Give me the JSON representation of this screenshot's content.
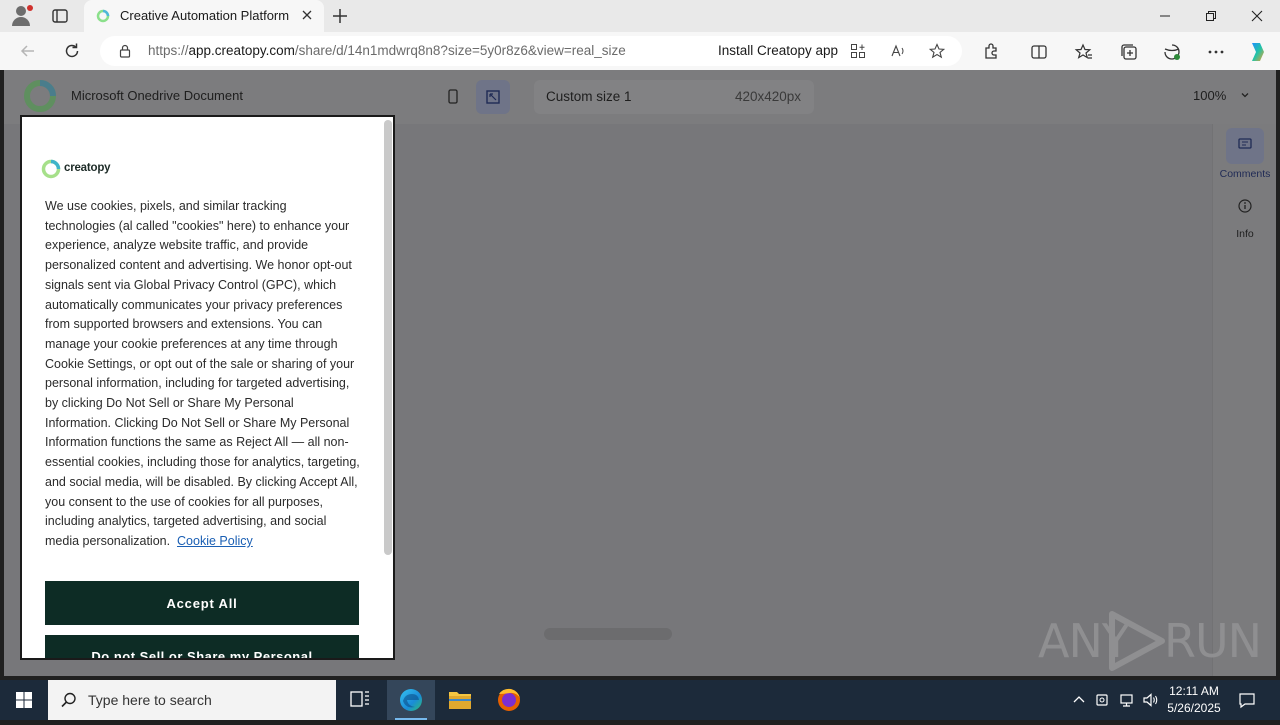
{
  "browser": {
    "tab_title": "Creative Automation Platform",
    "url_prefix": "https://",
    "url_host": "app.creatopy.com",
    "url_path": "/share/d/14n1mdwrq8n8?size=5y0r8z6&view=real_size",
    "install_label": "Install Creatopy app"
  },
  "app": {
    "document_title": "Microsoft Onedrive Document",
    "size_name": "Custom size 1",
    "size_dimensions": "420x420px",
    "zoom": "100%",
    "right_panel": {
      "comments_label": "Comments",
      "info_label": "Info"
    }
  },
  "cookie_banner": {
    "logo_text": "creatopy",
    "body_text": "We use cookies, pixels, and similar tracking technologies (al called \"cookies\" here) to enhance your experience, analyze website traffic, and provide personalized content and advertising. We honor opt-out signals sent via Global Privacy Control (GPC), which automatically communicates your privacy preferences from supported browsers and extensions. You can manage your cookie preferences at any time through Cookie Settings, or opt out of the sale or sharing of your personal information, including for targeted advertising, by clicking Do Not Sell or Share My Personal Information. Clicking Do Not Sell or Share My Personal Information functions the same as Reject All — all non-essential cookies, including those for analytics, targeting, and social media, will be disabled. By clicking Accept All, you consent to the use of cookies for all purposes, including analytics, targeted advertising, and social media personalization.",
    "policy_link": "Cookie Policy",
    "accept_label": "Accept All",
    "do_not_sell_label": "Do not Sell or Share my Personal"
  },
  "watermark": {
    "text_left": "ANY",
    "text_right": "RUN"
  },
  "taskbar": {
    "search_placeholder": "Type here to search",
    "time": "12:11 AM",
    "date": "5/26/2025"
  },
  "colors": {
    "accept_button": "#0d2c25",
    "link": "#1a5fb4",
    "overlay_page": "#7b7b7d",
    "taskbar": "#1c2a3a"
  }
}
